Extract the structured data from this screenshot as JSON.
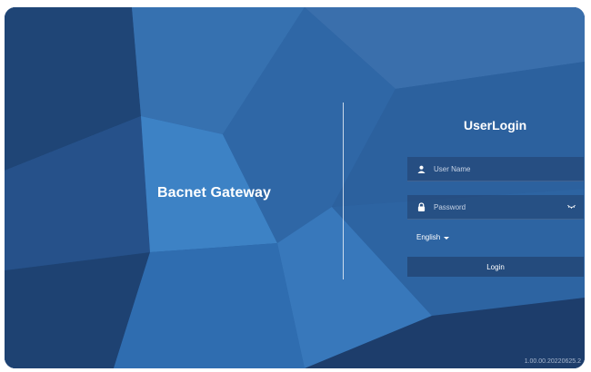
{
  "brand": {
    "title": "Bacnet Gateway"
  },
  "login": {
    "title": "UserLogin",
    "username_placeholder": "User Name",
    "password_placeholder": "Password",
    "language": "English",
    "submit_label": "Login"
  },
  "footer": {
    "version": "1.00.00.20220625.2"
  },
  "icons": {
    "user": "user-icon",
    "lock": "lock-icon",
    "eye": "eye-toggle-icon",
    "caret": "caret-down-icon"
  },
  "colors": {
    "background": "#2a5c97",
    "text": "#ffffff"
  }
}
